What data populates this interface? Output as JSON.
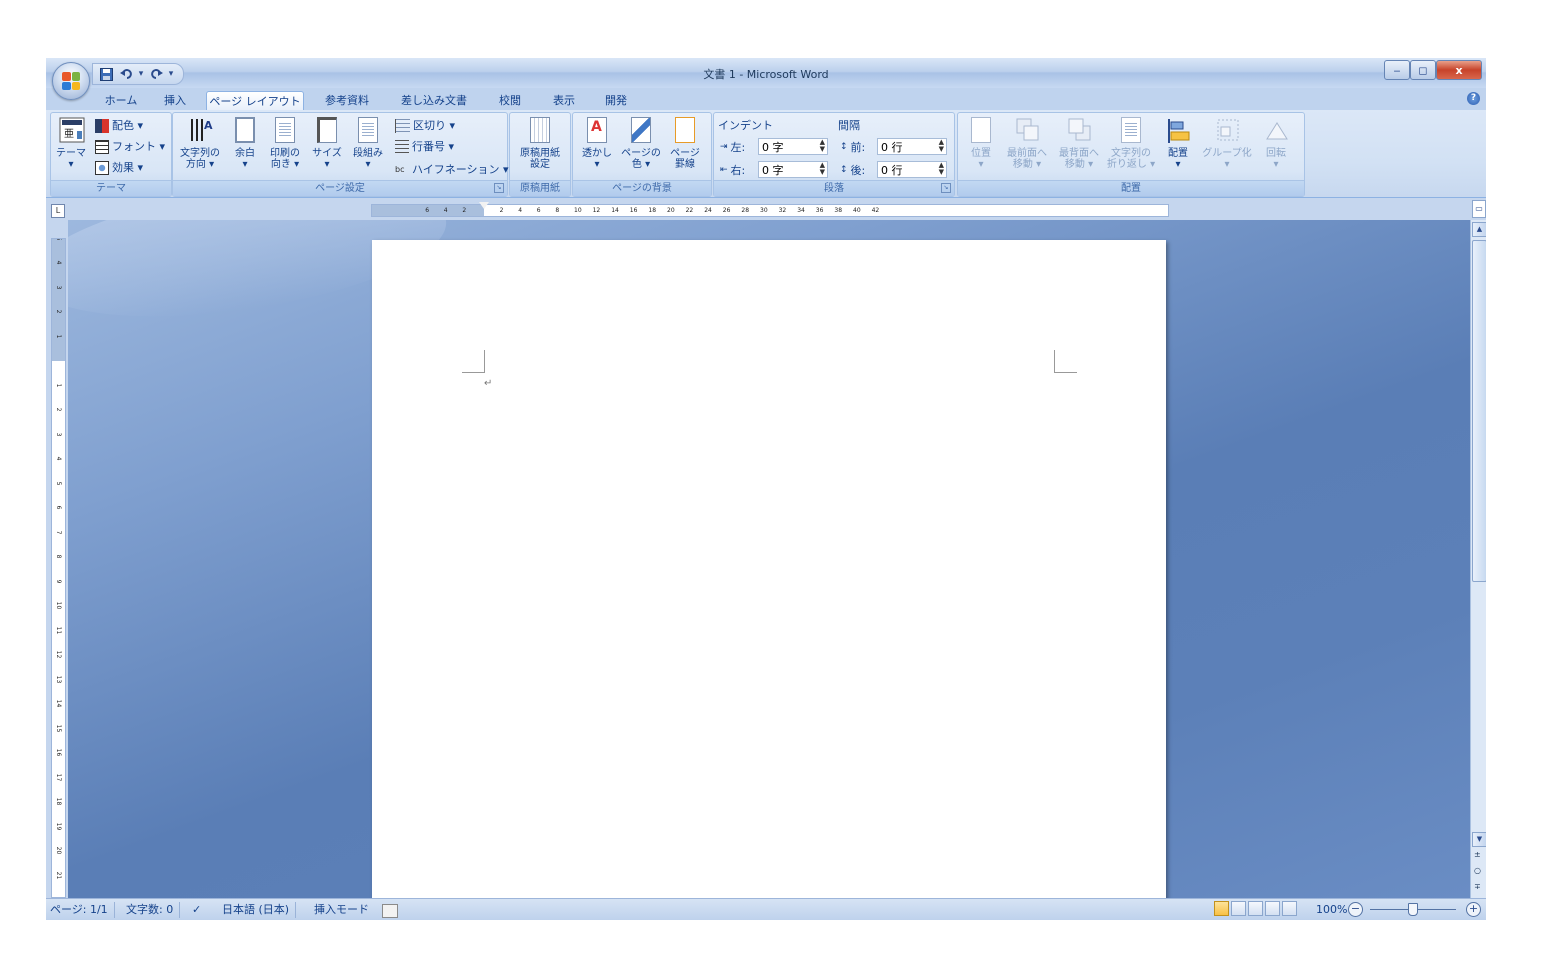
{
  "window": {
    "title": "文書 1 - Microsoft Word",
    "controls": {
      "minimize": "‒",
      "maximize": "◻",
      "close": "x"
    }
  },
  "qat": {
    "save_icon": "save-icon",
    "undo_icon": "undo-icon",
    "redo_icon": "redo-icon",
    "customize": "▾"
  },
  "tabs": [
    "ホーム",
    "挿入",
    "ページ レイアウト",
    "参考資料",
    "差し込み文書",
    "校閲",
    "表示",
    "開発"
  ],
  "active_tab": "ページ レイアウト",
  "help": "?",
  "ribbon": {
    "theme": {
      "label": "テーマ",
      "theme_btn": "テーマ",
      "colors": "配色 ▾",
      "fonts": "フォント ▾",
      "effects": "効果 ▾"
    },
    "page_setup": {
      "label": "ページ設定",
      "text_direction": [
        "文字列の",
        "方向 ▾"
      ],
      "margins": [
        "余白",
        "▾"
      ],
      "orientation": [
        "印刷の",
        "向き ▾"
      ],
      "size": [
        "サイズ",
        "▾"
      ],
      "columns": [
        "段組み",
        "▾"
      ],
      "breaks": "区切り ▾",
      "line_numbers": "行番号 ▾",
      "hyphenation": "ハイフネーション ▾"
    },
    "manuscript": {
      "label": "原稿用紙",
      "button": [
        "原稿用紙",
        "設定"
      ]
    },
    "page_background": {
      "label": "ページの背景",
      "watermark": [
        "透かし",
        "▾"
      ],
      "page_color": [
        "ページの",
        "色 ▾"
      ],
      "page_borders": [
        "ページ",
        "罫線"
      ]
    },
    "paragraph": {
      "label": "段落",
      "indent_title": "インデント",
      "spacing_title": "間隔",
      "indent_left_label": "左:",
      "indent_left_value": "0 字",
      "indent_right_label": "右:",
      "indent_right_value": "0 字",
      "spacing_before_label": "前:",
      "spacing_before_value": "0 行",
      "spacing_after_label": "後:",
      "spacing_after_value": "0 行"
    },
    "arrange": {
      "label": "配置",
      "position": [
        "位置",
        "▾"
      ],
      "bring_front": [
        "最前面へ",
        "移動 ▾"
      ],
      "send_back": [
        "最背面へ",
        "移動 ▾"
      ],
      "text_wrap": [
        "文字列の",
        "折り返し ▾"
      ],
      "align": [
        "配置",
        "▾"
      ],
      "group": [
        "グループ化",
        "▾"
      ],
      "rotate": [
        "回転",
        "▾"
      ]
    }
  },
  "ruler": {
    "tab_selector": "L",
    "h_numbers": [
      "6",
      "4",
      "2",
      "2",
      "4",
      "6",
      "8",
      "10",
      "12",
      "14",
      "16",
      "18",
      "20",
      "22",
      "24",
      "26",
      "28",
      "30",
      "32",
      "34",
      "36",
      "38",
      "40",
      "42"
    ],
    "v_numbers": [
      "5",
      "4",
      "3",
      "2",
      "1",
      "1",
      "2",
      "3",
      "4",
      "5",
      "6",
      "7",
      "8",
      "9",
      "10",
      "11",
      "12",
      "13",
      "14",
      "15",
      "16",
      "17",
      "18",
      "19",
      "20",
      "21"
    ]
  },
  "document": {
    "paragraph_mark": "↵"
  },
  "status": {
    "page": "ページ: 1/1",
    "words": "文字数: 0",
    "language": "日本語 (日本)",
    "mode": "挿入モード",
    "zoom": "100%",
    "zoom_minus": "−",
    "zoom_plus": "+"
  },
  "scrollbar": {
    "up": "▲",
    "down": "▼",
    "prev": "±",
    "select": "○",
    "next": "∓",
    "split": "▭"
  },
  "colors": {
    "accent": "#15428b",
    "background": "#5c80b8",
    "close": "#c7432a"
  }
}
